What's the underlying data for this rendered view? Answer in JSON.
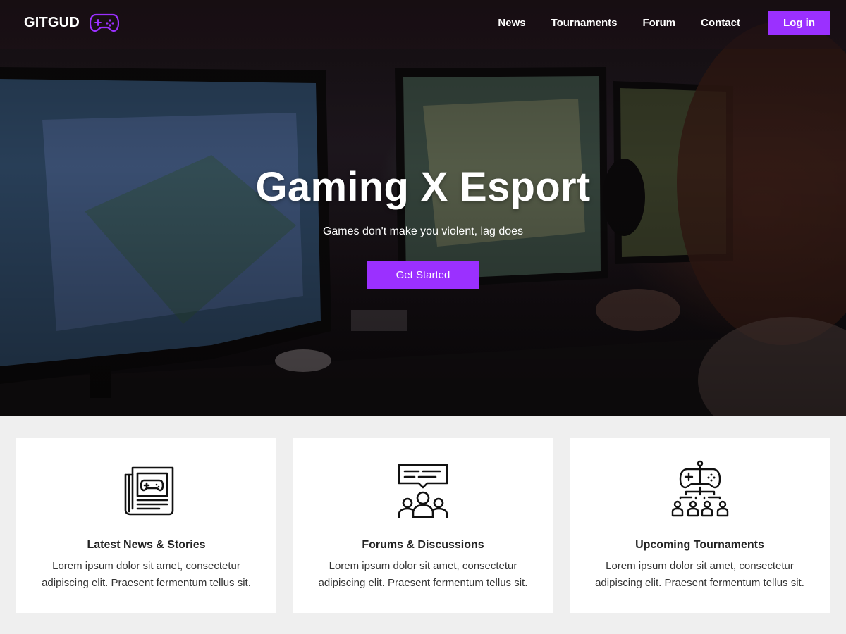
{
  "brand": {
    "name": "GITGUD",
    "icon": "gamepad-icon",
    "accent": "#9b30ff"
  },
  "nav": {
    "links": [
      "News",
      "Tournaments",
      "Forum",
      "Contact"
    ],
    "login_label": "Log in"
  },
  "hero": {
    "title": "Gaming X Esport",
    "subtitle": "Games don't make you violent, lag does",
    "cta_label": "Get Started"
  },
  "features": [
    {
      "icon": "newspaper-gamepad-icon",
      "title": "Latest News & Stories",
      "text": "Lorem ipsum dolor sit amet, consectetur adipiscing elit. Praesent fermentum tellus sit."
    },
    {
      "icon": "forum-chat-icon",
      "title": "Forums & Discussions",
      "text": "Lorem ipsum dolor sit amet, consectetur adipiscing elit. Praesent fermentum tellus sit."
    },
    {
      "icon": "tournament-bracket-icon",
      "title": "Upcoming Tournaments",
      "text": "Lorem ipsum dolor sit amet, consectetur adipiscing elit. Praesent fermentum tellus sit."
    }
  ]
}
